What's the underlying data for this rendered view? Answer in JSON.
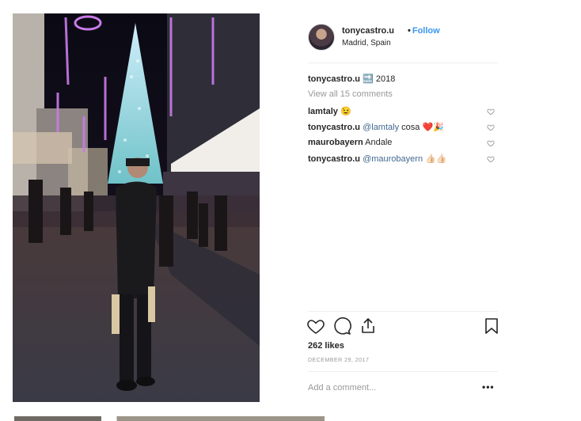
{
  "post": {
    "username": "tonycastro.u",
    "separator": "•",
    "follow_label": "Follow",
    "location": "Madrid, Spain",
    "caption": {
      "username": "tonycastro.u",
      "emoji": "🔜",
      "text": "2018"
    },
    "view_all_label": "View all 15 comments",
    "comments": [
      {
        "user": "lamtaly",
        "mention": "",
        "text": "😉"
      },
      {
        "user": "tonycastro.u",
        "mention": "@lamtaly",
        "text": "cosa ❤️🎉"
      },
      {
        "user": "maurobayern",
        "mention": "",
        "text": "Andale"
      },
      {
        "user": "tonycastro.u",
        "mention": "@maurobayern",
        "text": "👍🏻👍🏻"
      }
    ],
    "likes_label": "262 likes",
    "date_label": "DECEMBER 29, 2017",
    "add_comment_placeholder": "Add a comment...",
    "more_label": "•••"
  },
  "icons": {
    "like": "heart-icon",
    "comment": "comment-icon",
    "share": "share-icon",
    "save": "bookmark-icon",
    "comment_like": "heart-icon"
  },
  "colors": {
    "link_blue": "#3897f0",
    "muted": "#999999",
    "text": "#262626",
    "divider": "#efefef"
  }
}
